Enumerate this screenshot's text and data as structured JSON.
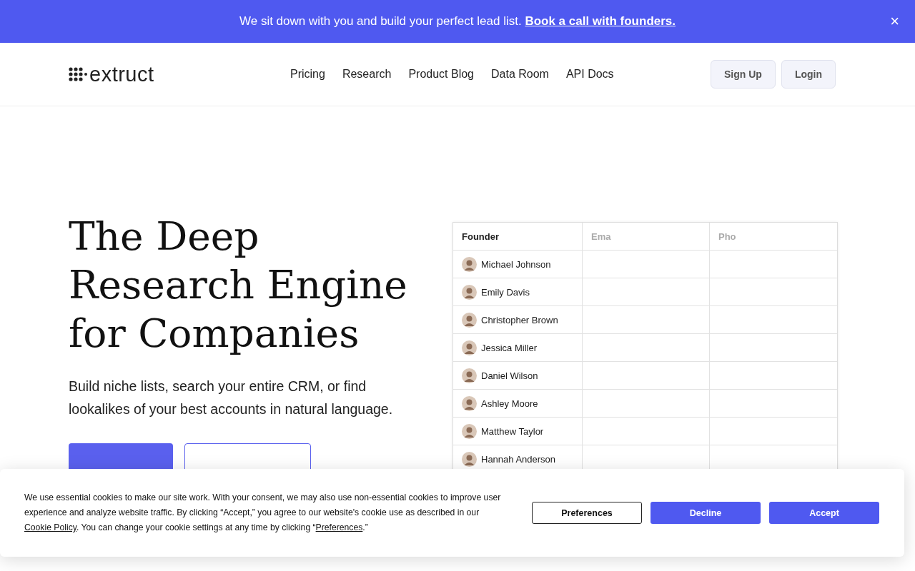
{
  "announcement": {
    "text": "We sit down with you and build your perfect lead list.",
    "link": "Book a call with founders.",
    "close": "×"
  },
  "nav": {
    "logo": "extruct",
    "links": [
      "Pricing",
      "Research",
      "Product Blog",
      "Data Room",
      "API Docs"
    ],
    "buttons": [
      "Sign Up",
      "Login"
    ]
  },
  "hero": {
    "title": "The Deep Research Engine for Companies",
    "subtitle": "Build niche lists, search your entire CRM, or find lookalikes of your best accounts in natural language."
  },
  "table": {
    "columns": [
      {
        "label": "Founder",
        "faded": false
      },
      {
        "label": "Ema",
        "faded": true
      },
      {
        "label": "Pho",
        "faded": true
      }
    ],
    "rows": [
      "Michael Johnson",
      "Emily Davis",
      "Christopher Brown",
      "Jessica Miller",
      "Daniel Wilson",
      "Ashley Moore",
      "Matthew Taylor",
      "Hannah Anderson"
    ]
  },
  "cookie_banner": {
    "parts": [
      {
        "kind": "text",
        "text": "We use essential cookies to make our site work. With your consent, we may also use non-essential cookies to improve user experience and analyze website traffic. By clicking “Accept,” you agree to our website's cookie use as described in our "
      },
      {
        "kind": "link",
        "text": "Cookie Policy"
      },
      {
        "kind": "text",
        "text": ". You can change your cookie settings at any time by clicking “"
      },
      {
        "kind": "link",
        "text": "Preferences"
      },
      {
        "kind": "text",
        "text": ".”"
      }
    ],
    "buttons": [
      {
        "label": "Preferences",
        "kind": "outline"
      },
      {
        "label": "Decline",
        "kind": "solid"
      },
      {
        "label": "Accept",
        "kind": "solid"
      }
    ]
  }
}
